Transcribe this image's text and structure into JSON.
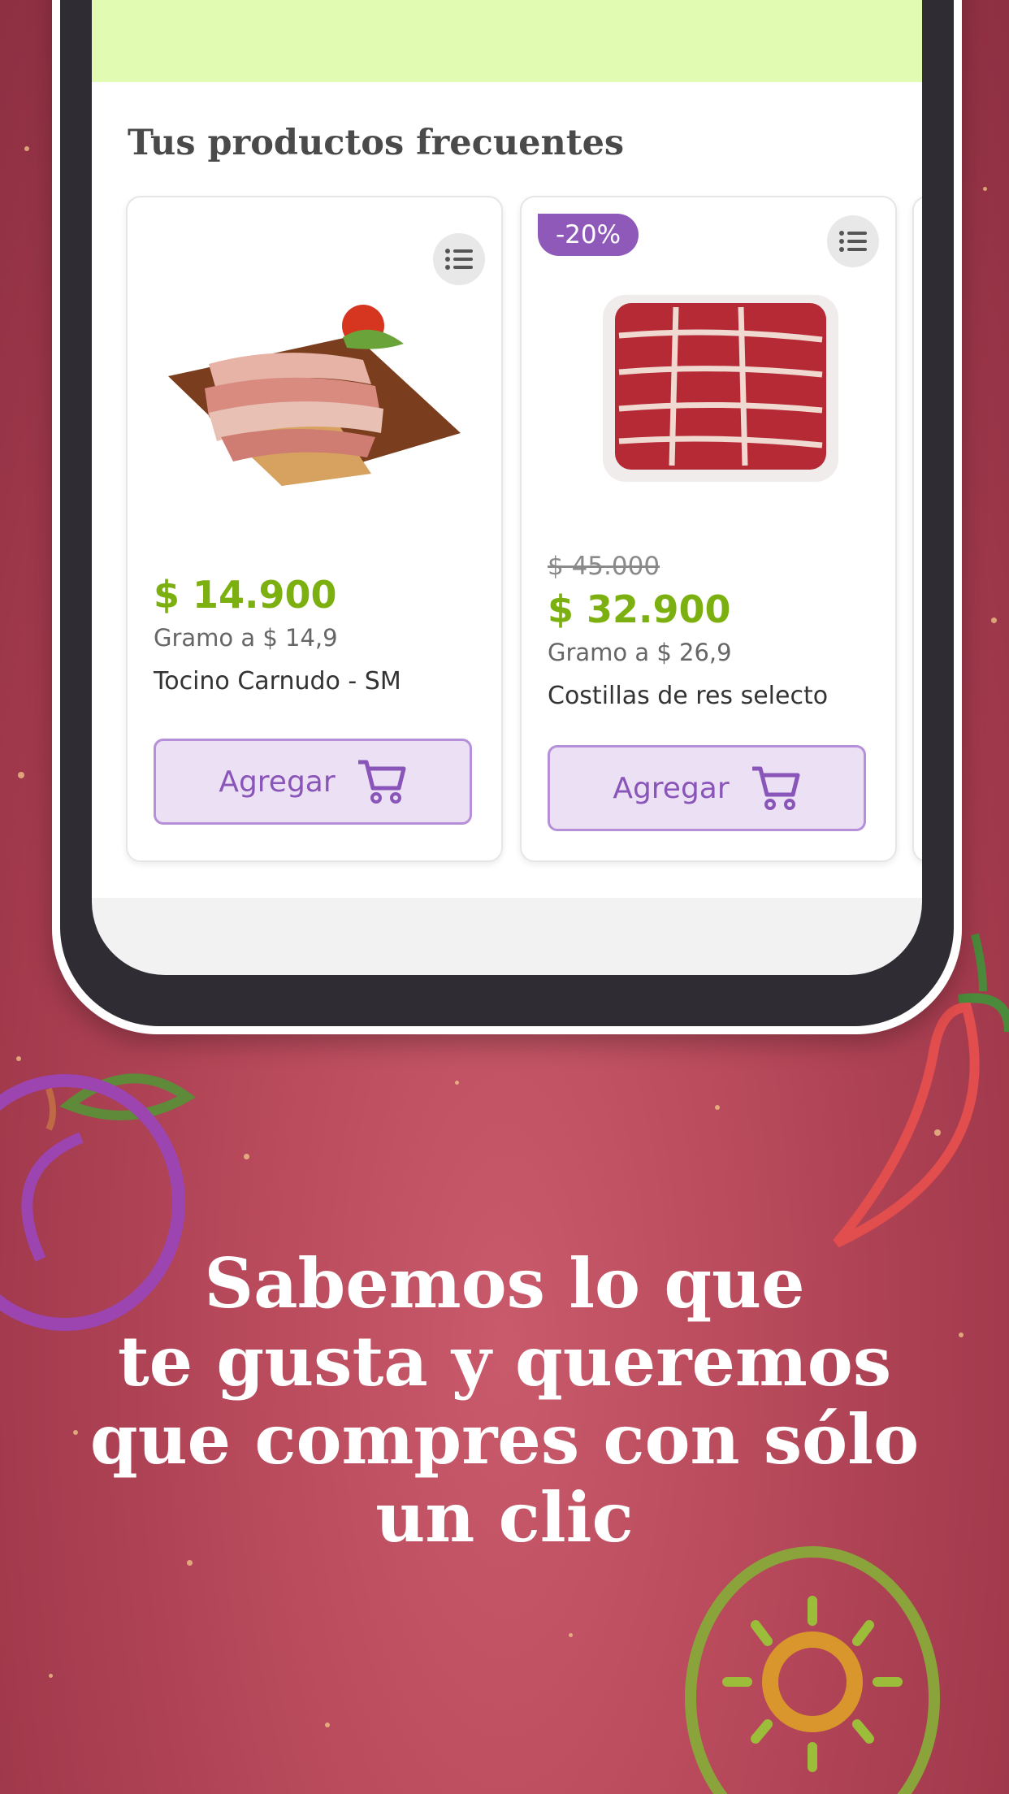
{
  "section": {
    "title": "Tus productos frecuentes"
  },
  "products": [
    {
      "name": "Tocino Carnudo - SM",
      "price": "$ 14.900",
      "unit_price": "Gramo a $ 14,9",
      "add_label": "Agregar",
      "image_icon": "bacon-board-image"
    },
    {
      "badge": "-20%",
      "old_price": "$ 45.000",
      "name": "Costillas de res selecto",
      "price": "$ 32.900",
      "unit_price": "Gramo a $ 26,9",
      "add_label": "Agregar",
      "image_icon": "beef-ribs-tray-image"
    }
  ],
  "headline": {
    "line1": "Sabemos lo que",
    "line2": "te gusta y queremos",
    "line3": "que compres con sólo",
    "line4": "un clic"
  },
  "colors": {
    "price": "#7cb010",
    "accent_purple": "#8e59b8",
    "banner": "#e2fbb3",
    "background": "#b84a5c"
  }
}
